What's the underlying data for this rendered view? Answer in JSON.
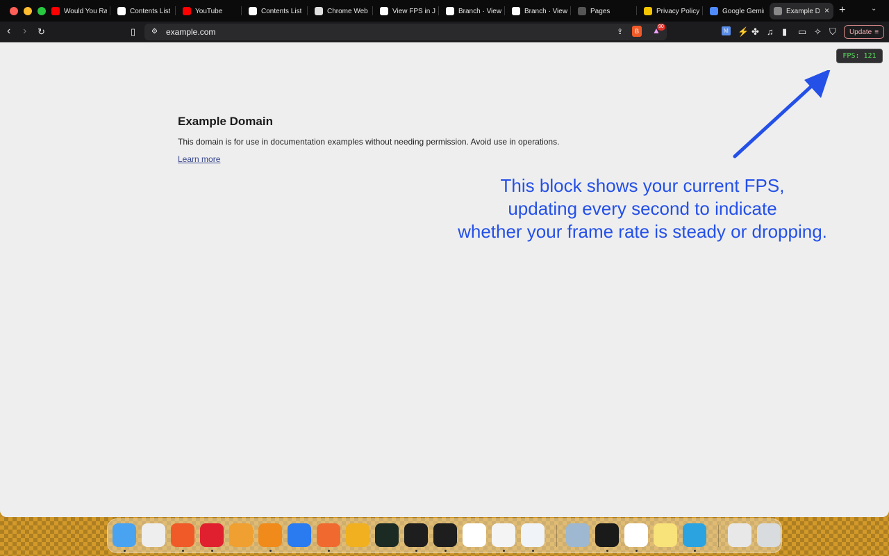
{
  "tabs": [
    {
      "title": "Would You Ra",
      "favicon": "youtube-icon",
      "color": "#ff0000"
    },
    {
      "title": "Contents List",
      "favicon": "notion-icon",
      "color": "#ffffff"
    },
    {
      "title": "YouTube",
      "favicon": "youtube-icon",
      "color": "#ff0000"
    },
    {
      "title": "Contents List",
      "favicon": "notion-icon",
      "color": "#ffffff"
    },
    {
      "title": "Chrome Web",
      "favicon": "chrome-web-store-icon",
      "color": "#e0e0e0"
    },
    {
      "title": "View FPS in J",
      "favicon": "openai-icon",
      "color": "#ffffff"
    },
    {
      "title": "Branch · View",
      "favicon": "openai-icon",
      "color": "#ffffff"
    },
    {
      "title": "Branch · View",
      "favicon": "openai-icon",
      "color": "#ffffff"
    },
    {
      "title": "Pages",
      "favicon": "github-icon",
      "color": "#555555"
    },
    {
      "title": "Privacy Policy",
      "favicon": "bolt-icon",
      "color": "#f5c400"
    },
    {
      "title": "Google Gemin",
      "favicon": "gemini-icon",
      "color": "#4f8bff"
    },
    {
      "title": "Example D",
      "favicon": "globe-icon",
      "color": "#888888",
      "active": true
    }
  ],
  "toolbar": {
    "url": "example.com",
    "brave_shields_badge": "90",
    "update_label": "Update"
  },
  "page": {
    "title": "Example Domain",
    "body": "This domain is for use in documentation examples without needing permission. Avoid use in operations.",
    "link": "Learn more"
  },
  "fps_badge": "FPS: 121",
  "annotation": {
    "lines": [
      "This block shows your current FPS,",
      "updating every second to indicate",
      "whether your frame rate is steady or dropping."
    ],
    "color": "#2450e8"
  },
  "dock": [
    {
      "name": "finder-icon",
      "color": "#4aa3f0"
    },
    {
      "name": "launchpad-icon",
      "color": "#eeeeee"
    },
    {
      "name": "brave-icon",
      "color": "#f05a28"
    },
    {
      "name": "opera-icon",
      "color": "#e0202e"
    },
    {
      "name": "photos-icon",
      "color": "#f0a030"
    },
    {
      "name": "books-icon",
      "color": "#f08a1a"
    },
    {
      "name": "app-store-icon",
      "color": "#2a7af0"
    },
    {
      "name": "postman-icon",
      "color": "#f06a30"
    },
    {
      "name": "tableplus-icon",
      "color": "#f0b020"
    },
    {
      "name": "activity-monitor-icon",
      "color": "#1c2a24"
    },
    {
      "name": "figma-icon",
      "color": "#1e1e1e"
    },
    {
      "name": "terminal-icon",
      "color": "#1e1e1e"
    },
    {
      "name": "capcut-icon",
      "color": "#ffffff"
    },
    {
      "name": "freeform-icon",
      "color": "#f4f4f4"
    },
    {
      "name": "vscode-icon",
      "color": "#f0f4f8"
    },
    {
      "name": "preview-icon",
      "color": "#9db8d0"
    },
    {
      "name": "terminal-alt-icon",
      "color": "#1a1a1a"
    },
    {
      "name": "chrome-icon",
      "color": "#ffffff"
    },
    {
      "name": "notes-icon",
      "color": "#f8e27a"
    },
    {
      "name": "telegram-icon",
      "color": "#2aa3e0"
    },
    {
      "name": "documents-icon",
      "color": "#e8e8e8"
    },
    {
      "name": "trash-icon",
      "color": "#d8dcdf"
    }
  ]
}
